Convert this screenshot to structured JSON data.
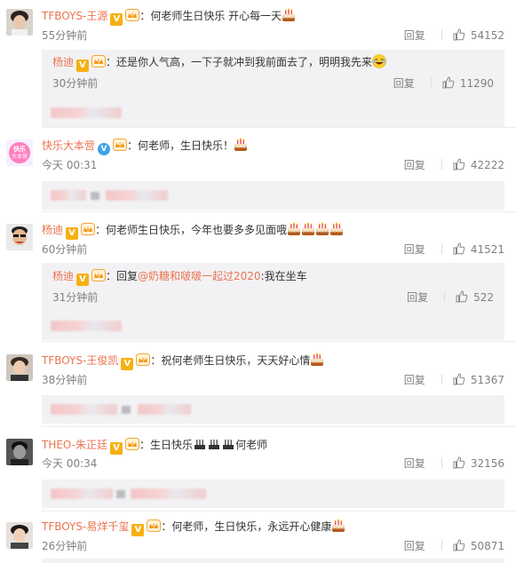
{
  "comments": [
    {
      "username": "TFBOYS-王源",
      "text": "：何老师生日快乐  开心每一天",
      "time": "55分钟前",
      "reply_label": "回复",
      "likes": "54152",
      "reply": {
        "username": "杨迪",
        "text": "：还是你人气高，一下子就冲到我前面去了，明明我先来",
        "time": "30分钟前",
        "reply_label": "回复",
        "likes": "11290"
      }
    },
    {
      "username": "快乐大本营",
      "text": "：何老师，生日快乐！",
      "time": "今天 00:31",
      "reply_label": "回复",
      "likes": "42222"
    },
    {
      "username": "杨迪",
      "text": "：何老师生日快乐，今年也要多多见面哦",
      "time": "60分钟前",
      "reply_label": "回复",
      "likes": "41521",
      "reply": {
        "username": "杨迪",
        "prefix": "：回复",
        "mention": "@奶糖和啵啵一起过2020",
        "text": ":我在坐车",
        "time": "31分钟前",
        "reply_label": "回复",
        "likes": "522"
      }
    },
    {
      "username": "TFBOYS-王俊凯",
      "text": "：祝何老师生日快乐，天天好心情",
      "time": "38分钟前",
      "reply_label": "回复",
      "likes": "51367"
    },
    {
      "username": "THEO-朱正廷",
      "text_a": "：生日快乐",
      "text_b": "何老师",
      "time": "今天 00:34",
      "reply_label": "回复",
      "likes": "32156"
    },
    {
      "username": "TFBOYS-易烊千玺",
      "text": "：何老师，生日快乐，永远开心健康",
      "time": "26分钟前",
      "reply_label": "回复",
      "likes": "50871"
    }
  ],
  "colors": {
    "username": "#eb7350",
    "meta": "#808080",
    "reply_bg": "#f2f2f5",
    "verified_gold": "#f7b013",
    "verified_blue": "#3ea3e6"
  },
  "icons": [
    "cake-emoji",
    "laugh-emoji",
    "thumbs-up-icon",
    "verified-v-icon",
    "crown-badge-icon",
    "candle-emoji"
  ]
}
